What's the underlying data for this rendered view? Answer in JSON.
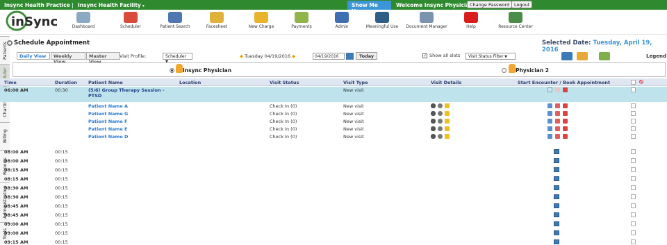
{
  "topbar": {
    "practice": "Insync Health Practice",
    "separator": "|",
    "facility": "Insync Health Facility",
    "show_me_how": "Show Me How >",
    "welcome": "Welcome Insync Physician|",
    "change_password": "Change Password",
    "logout": "Logout"
  },
  "toolbar": {
    "logo_text": "inSync",
    "items": [
      {
        "label": "Dashboard",
        "icon": "dashboard-icon",
        "color": "#8ca9c4"
      },
      {
        "label": "Scheduler",
        "icon": "scheduler-icon",
        "color": "#d94b3a"
      },
      {
        "label": "Patient Search",
        "icon": "patient-search-icon",
        "color": "#4f78b2"
      },
      {
        "label": "Facesheet",
        "icon": "facesheet-icon",
        "color": "#e0b23a"
      },
      {
        "label": "New Charge",
        "icon": "new-charge-icon",
        "color": "#e7b42c"
      },
      {
        "label": "Payments",
        "icon": "payments-icon",
        "color": "#8fb44a"
      },
      {
        "label": "Admin",
        "icon": "admin-icon",
        "color": "#3f6fb0"
      },
      {
        "label": "Meaningful Use",
        "icon": "meaningful-use-icon",
        "color": "#2f5f86"
      },
      {
        "label": "Document Manager",
        "icon": "document-manager-icon",
        "color": "#7b93ad"
      },
      {
        "label": "Help",
        "icon": "help-icon",
        "color": "#d91d1d"
      },
      {
        "label": "Resource Center",
        "icon": "resource-center-icon",
        "color": "#4b8c49"
      }
    ]
  },
  "header": {
    "title": "Schedule Appointment",
    "selected_date_label": "Selected Date:",
    "selected_date": "Tuesday, April 19, 2016"
  },
  "left_tabs": [
    "Patients",
    "Scheduler",
    "Charting",
    "Billing",
    "Reports",
    "Administration",
    "Tools"
  ],
  "views": {
    "daily": "Daily View",
    "weekly": "Weekly View",
    "master": "Master View",
    "visit_profile_label": "Visit Profile:",
    "visit_profile_value": "Scheduler",
    "date_nav": "Tuesday 04/19/2016",
    "date_input": "04/19/2016",
    "today": "Today",
    "show_all": "Show all slots",
    "visit_status_filter": "Visit Status Filter",
    "legend": "Legend"
  },
  "physicians": [
    "Insync Physician",
    "Physician 2"
  ],
  "table": {
    "columns": [
      "Time",
      "Duration",
      "Patient Name",
      "Location",
      "Visit Status",
      "Visit Type",
      "Visit Details",
      "Start Encounter / Book Appointment"
    ],
    "group": {
      "time": "06:00 AM",
      "duration": "00:30",
      "name": "(5/6) Group Therapy Session - PTSD",
      "type": "New visit"
    },
    "patients": [
      {
        "name": "Patient Name A",
        "status": "Check In (0)",
        "type": "New visit"
      },
      {
        "name": "Patient Name G",
        "status": "Check In (0)",
        "type": "New visit"
      },
      {
        "name": "Patient Name F",
        "status": "Check In (0)",
        "type": "New visit"
      },
      {
        "name": "Patient Name E",
        "status": "Check In (0)",
        "type": "New visit"
      },
      {
        "name": "Patient Name D",
        "status": "Check In (0)",
        "type": "New visit"
      }
    ],
    "slots": [
      {
        "time": "08:00 AM",
        "duration": "00:15"
      },
      {
        "time": "08:00 AM",
        "duration": "00:15"
      },
      {
        "time": "08:15 AM",
        "duration": "00:15"
      },
      {
        "time": "08:15 AM",
        "duration": "00:15"
      },
      {
        "time": "08:30 AM",
        "duration": "00:15"
      },
      {
        "time": "08:30 AM",
        "duration": "00:15"
      },
      {
        "time": "08:45 AM",
        "duration": "00:15"
      },
      {
        "time": "08:45 AM",
        "duration": "00:15"
      },
      {
        "time": "09:00 AM",
        "duration": "00:15"
      },
      {
        "time": "09:00 AM",
        "duration": "00:15"
      },
      {
        "time": "09:15 AM",
        "duration": "00:15"
      }
    ]
  }
}
